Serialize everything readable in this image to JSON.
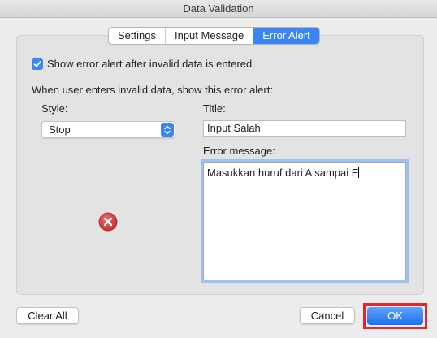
{
  "window": {
    "title": "Data Validation"
  },
  "tabs": [
    {
      "label": "Settings",
      "active": false
    },
    {
      "label": "Input Message",
      "active": false
    },
    {
      "label": "Error Alert",
      "active": true
    }
  ],
  "show_alert": {
    "label": "Show error alert after invalid data is entered",
    "checked": true
  },
  "instruction": "When user enters invalid data, show this error alert:",
  "style": {
    "label": "Style:",
    "value": "Stop",
    "icon": "stop-error-icon"
  },
  "title": {
    "label": "Title:",
    "value": "Input Salah"
  },
  "error_message": {
    "label": "Error message:",
    "value": "Masukkan huruf dari A sampai E"
  },
  "buttons": {
    "clear_all": "Clear All",
    "cancel": "Cancel",
    "ok": "OK"
  },
  "colors": {
    "accent": "#3b86f7",
    "stop_red": "#d8393b",
    "highlight_outline": "#e3262a"
  }
}
